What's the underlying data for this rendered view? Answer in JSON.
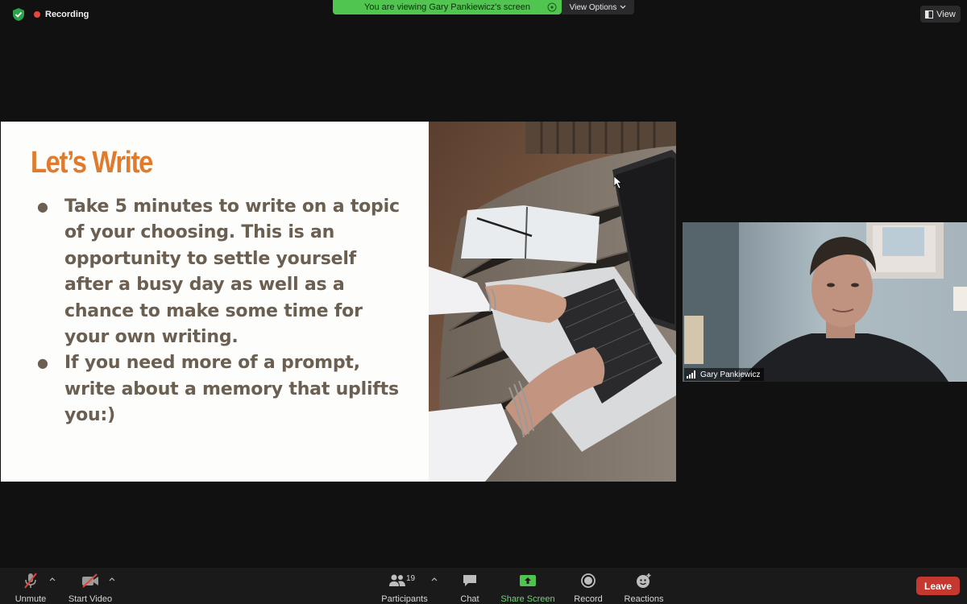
{
  "top": {
    "recording_label": "Recording",
    "viewing_banner": "You are viewing Gary Pankiewicz's screen",
    "view_options_label": "View Options",
    "view_button_label": "View"
  },
  "slide": {
    "title": "Let’s Write",
    "bullets": [
      "Take 5 minutes to write on a topic of your choosing.  This is an opportunity to settle yourself after a busy day as well as a chance to make some time for your own writing.",
      "If you need more of a prompt, write about a memory that uplifts you:)"
    ]
  },
  "participant": {
    "name": "Gary Pankiewicz"
  },
  "toolbar": {
    "unmute_label": "Unmute",
    "start_video_label": "Start Video",
    "participants_label": "Participants",
    "participants_count": "19",
    "chat_label": "Chat",
    "share_screen_label": "Share Screen",
    "record_label": "Record",
    "reactions_label": "Reactions",
    "leave_label": "Leave"
  },
  "colors": {
    "accent_green": "#50c54f",
    "leave_red": "#c5382f",
    "slide_title": "#e07a2c",
    "slide_text": "#6b5f52"
  },
  "icons": [
    "shield-icon",
    "record-dot-icon",
    "info-icon",
    "chevron-down-icon",
    "view-grid-icon",
    "signal-icon",
    "microphone-muted-icon",
    "video-off-icon",
    "participants-icon",
    "chat-icon",
    "share-screen-icon",
    "record-icon",
    "reactions-icon"
  ]
}
